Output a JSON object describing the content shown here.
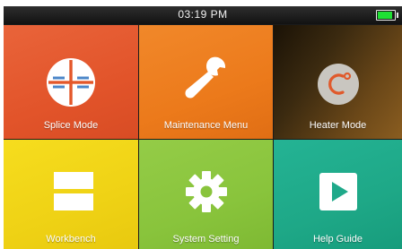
{
  "status_bar": {
    "time": "03:19 PM",
    "battery_level": 0.9,
    "battery_color": "#1fe034"
  },
  "tiles": [
    {
      "label": "Splice Mode",
      "icon": "splice-cross-icon",
      "color": "#e4572a"
    },
    {
      "label": "Maintenance Menu",
      "icon": "wrench-icon",
      "color": "#ee7d1c"
    },
    {
      "label": "Heater Mode",
      "icon": "heater-c-degree-icon",
      "color": "#3a2a12"
    },
    {
      "label": "Workbench",
      "icon": "workbench-panel-icon",
      "color": "#f0d61a"
    },
    {
      "label": "System Setting",
      "icon": "gear-icon",
      "color": "#8cc63e"
    },
    {
      "label": "Help Guide",
      "icon": "play-icon",
      "color": "#1fa98a"
    }
  ]
}
